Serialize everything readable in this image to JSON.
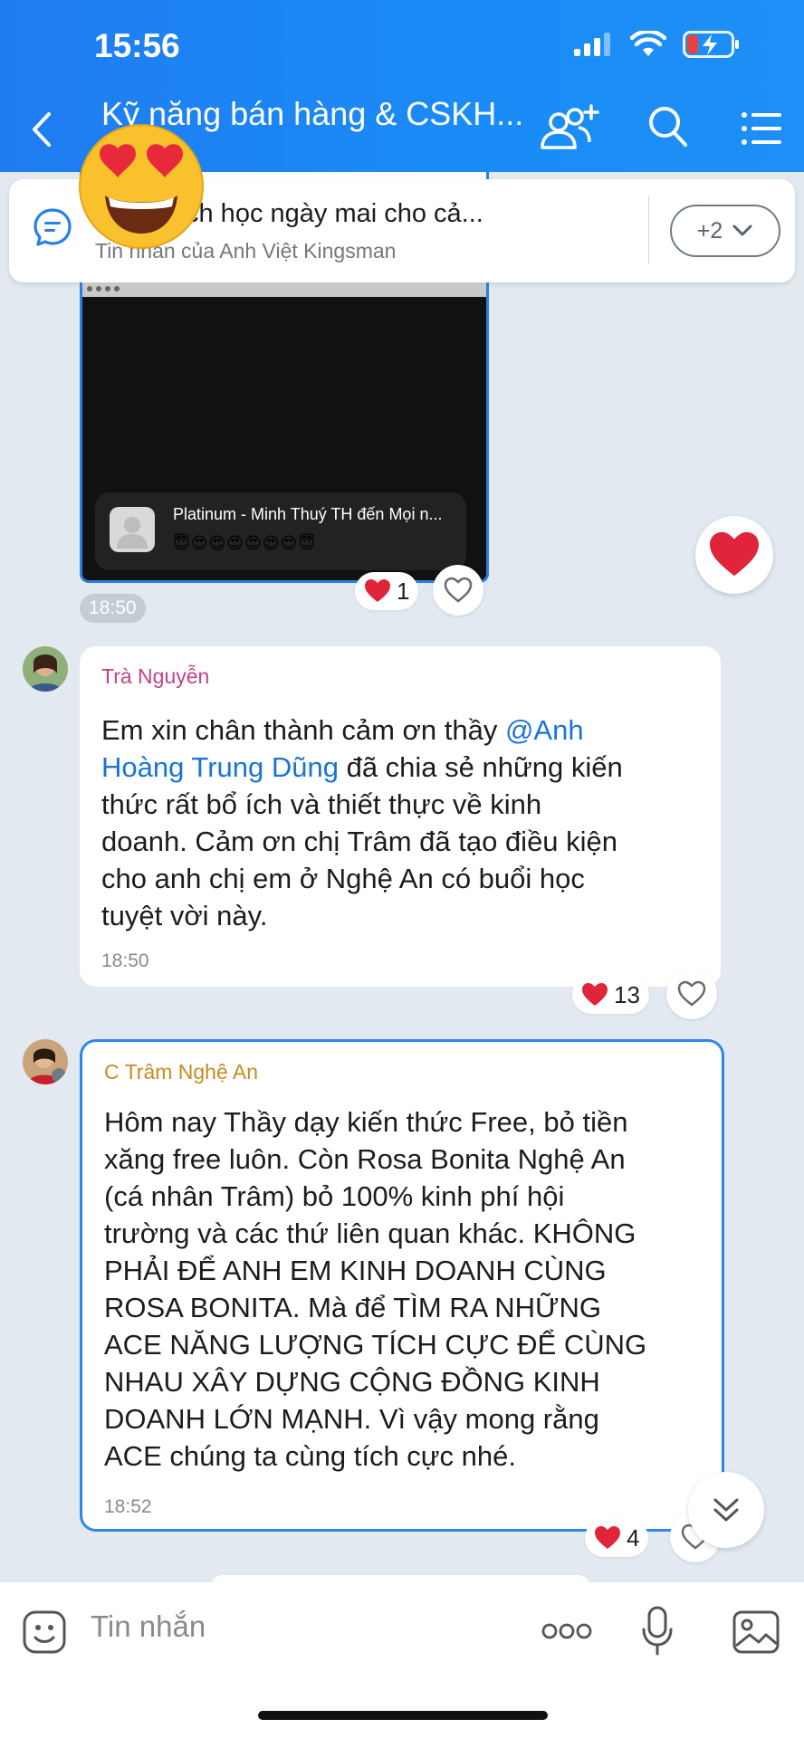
{
  "status": {
    "time": "15:56"
  },
  "header": {
    "title": "Kỹ năng bán hàng & CSKH..."
  },
  "pinned": {
    "text": "gửi lại lịch học ngày mai cho cả...",
    "sub": "Tin nhắn của Anh Việt Kingsman",
    "more": "+2"
  },
  "video_message": {
    "card_name": "Platinum - Minh Thuý TH đến Mọi n...",
    "card_emojis": "😇😍😍😍😍😍😍😇",
    "reaction_count": "1",
    "time": "18:50"
  },
  "messages": [
    {
      "sender": "Trà Nguyễn",
      "sender_color": "#c2418a",
      "lines": [
        {
          "pre": "Em xin chân thành cảm ơn thầy ",
          "mention": "@Anh"
        },
        {
          "pre": "",
          "mention": "Hoàng Trung Dũng",
          "post": " đã chia sẻ những kiến"
        },
        {
          "pre": "thức rất bổ ích và thiết thực về kinh"
        },
        {
          "pre": "doanh. Cảm ơn chị Trâm đã tạo điều kiện"
        },
        {
          "pre": "cho anh chị em ở Nghệ An có buổi học"
        },
        {
          "pre": "tuyệt vời này."
        }
      ],
      "time": "18:50",
      "reaction_count": "13"
    },
    {
      "sender": "C Trâm Nghệ An",
      "sender_color": "#c88a1e",
      "lines": [
        "Hôm nay Thầy dạy kiến thức Free, bỏ tiền",
        "xăng free luôn. Còn Rosa Bonita Nghệ An",
        "(cá nhân Trâm) bỏ 100% kinh phí hội",
        "trường và các thứ liên quan khác. KHÔNG",
        "PHẢI ĐỂ ANH EM KINH DOANH CÙNG",
        "ROSA BONITA. Mà để TÌM RA NHỮNG",
        "ACE NĂNG LƯỢNG TÍCH CỰC ĐỂ CÙNG",
        "NHAU XÂY DỰNG CỘNG ĐỒNG KINH",
        "DOANH LỚN MẠNH. Vì vậy mong rằng",
        "ACE chúng ta cùng tích cực nhé."
      ],
      "time": "18:52",
      "reaction_count": "4"
    }
  ],
  "composer": {
    "placeholder": "Tin nhắn"
  },
  "colors": {
    "header": "#1a8cf7",
    "mention": "#1a73d9",
    "highlight_border": "#2f86ea",
    "heart": "#e0243a"
  }
}
